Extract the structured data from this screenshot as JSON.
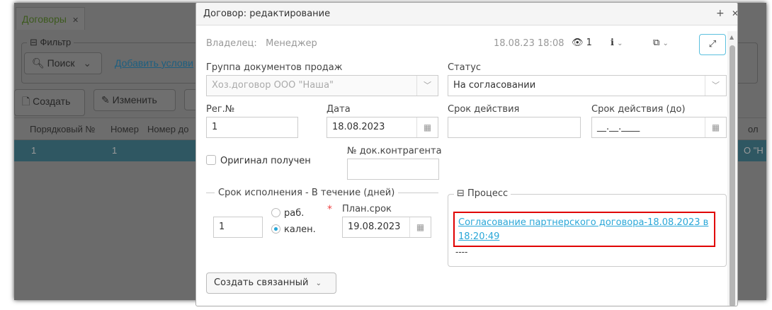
{
  "background": {
    "tab": "Договоры",
    "filter_legend": "Фильтр",
    "search_button": "Поиск",
    "add_condition_link": "Добавить услови",
    "create_button": "Создать",
    "edit_button": "Изменить",
    "columns": [
      "Порядковый №",
      "Номер",
      "Номер до",
      "ол"
    ],
    "row": [
      "1",
      "1",
      "",
      "О \"Н"
    ]
  },
  "dialog": {
    "title": "Договор: редактирование",
    "owner_label": "Владелец:",
    "owner_value": "Менеджер",
    "timestamp": "18.08.23 18:08",
    "views": "1",
    "sales_group_label": "Группа документов продаж",
    "sales_group_value": "Хоз.договор ООО \"Наша\"",
    "status_label": "Статус",
    "status_value": "На согласовании",
    "reg_label": "Рег.№",
    "reg_value": "1",
    "date_label": "Дата",
    "date_value": "18.08.2023",
    "validity_label": "Срок действия",
    "validity_value": "",
    "validity_to_label": "Срок действия (до)",
    "validity_to_value": "__.__.____",
    "original_label": "Оригинал получен",
    "original_checked": false,
    "counterparty_doc_label": "№ док.контрагента",
    "counterparty_doc_value": "",
    "term_legend": "Срок исполнения - В течение (дней)",
    "term_days": "1",
    "radio_work": "раб.",
    "radio_calendar": "кален.",
    "radio_selected": "кален.",
    "required_mark": "*",
    "plan_label": "План.срок",
    "plan_value": "19.08.2023",
    "process_legend": "Процесс",
    "process_link": "Согласование партнерского договора-18.08.2023 в 18:20:49",
    "process_extra": "----",
    "create_related_button": "Создать связанный",
    "highlight_color": "#e00000",
    "link_color": "#2aa7d8"
  }
}
